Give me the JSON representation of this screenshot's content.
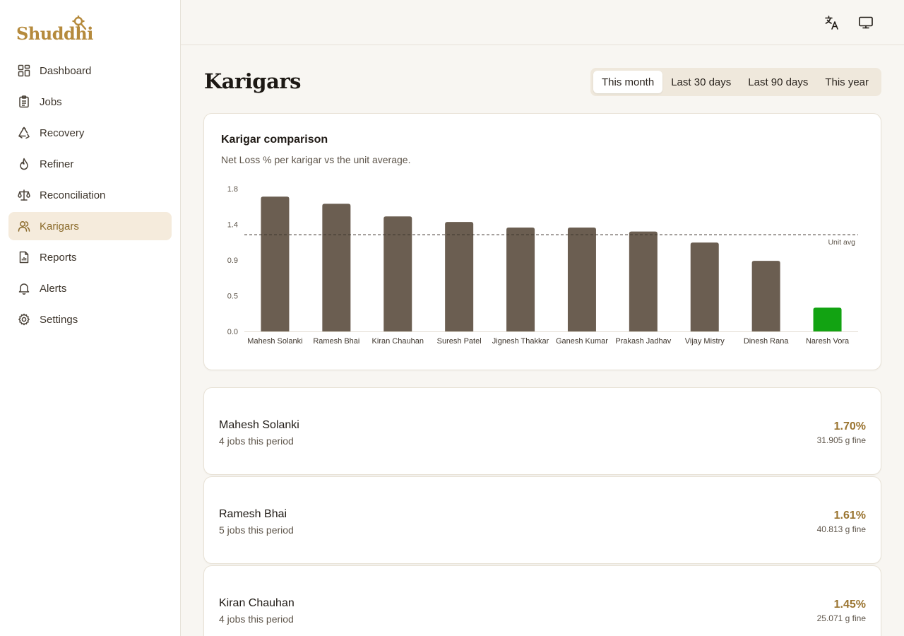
{
  "app": {
    "logo": "Shuddhi"
  },
  "sidebar": {
    "items": [
      {
        "label": "Dashboard",
        "icon": "dashboard-icon"
      },
      {
        "label": "Jobs",
        "icon": "clipboard-icon"
      },
      {
        "label": "Recovery",
        "icon": "recycle-icon"
      },
      {
        "label": "Refiner",
        "icon": "flame-icon"
      },
      {
        "label": "Reconciliation",
        "icon": "scale-icon"
      },
      {
        "label": "Karigars",
        "icon": "users-icon",
        "active": true
      },
      {
        "label": "Reports",
        "icon": "report-icon"
      },
      {
        "label": "Alerts",
        "icon": "bell-icon"
      },
      {
        "label": "Settings",
        "icon": "gear-icon"
      }
    ]
  },
  "topbar": {
    "icons": [
      "translate-icon",
      "monitor-icon"
    ]
  },
  "page": {
    "title": "Karigars"
  },
  "range_tabs": [
    "This month",
    "Last 30 days",
    "Last 90 days",
    "This year"
  ],
  "range_selected": "This month",
  "chart_card": {
    "title": "Karigar comparison",
    "subtitle": "Net Loss % per karigar vs the unit average."
  },
  "colors": {
    "bar": "#6b5e51",
    "best_bar": "#12a312",
    "accent": "#9a7430",
    "active_bg": "#f5ebdc"
  },
  "chart_data": {
    "type": "bar",
    "categories": [
      "Mahesh Solanki",
      "Ramesh Bhai",
      "Kiran Chauhan",
      "Suresh Patel",
      "Jignesh Thakkar",
      "Ganesh Kumar",
      "Prakash Jadhav",
      "Vijay Mistry",
      "Dinesh Rana",
      "Naresh Vora"
    ],
    "values": [
      1.7,
      1.61,
      1.45,
      1.38,
      1.31,
      1.31,
      1.26,
      1.12,
      0.89,
      0.3
    ],
    "yticks": [
      "0.0",
      "0.5",
      "0.9",
      "1.4",
      "1.8"
    ],
    "ylim": [
      0,
      1.8
    ],
    "reference_line": {
      "value": 1.22,
      "label": "Unit avg"
    },
    "highlight_index": 9,
    "grid": false
  },
  "karigars": [
    {
      "name": "Mahesh Solanki",
      "jobs": "4 jobs this period",
      "loss_pct": "1.70%",
      "fine": "31.905 g fine"
    },
    {
      "name": "Ramesh Bhai",
      "jobs": "5 jobs this period",
      "loss_pct": "1.61%",
      "fine": "40.813 g fine"
    },
    {
      "name": "Kiran Chauhan",
      "jobs": "4 jobs this period",
      "loss_pct": "1.45%",
      "fine": "25.071 g fine"
    }
  ]
}
